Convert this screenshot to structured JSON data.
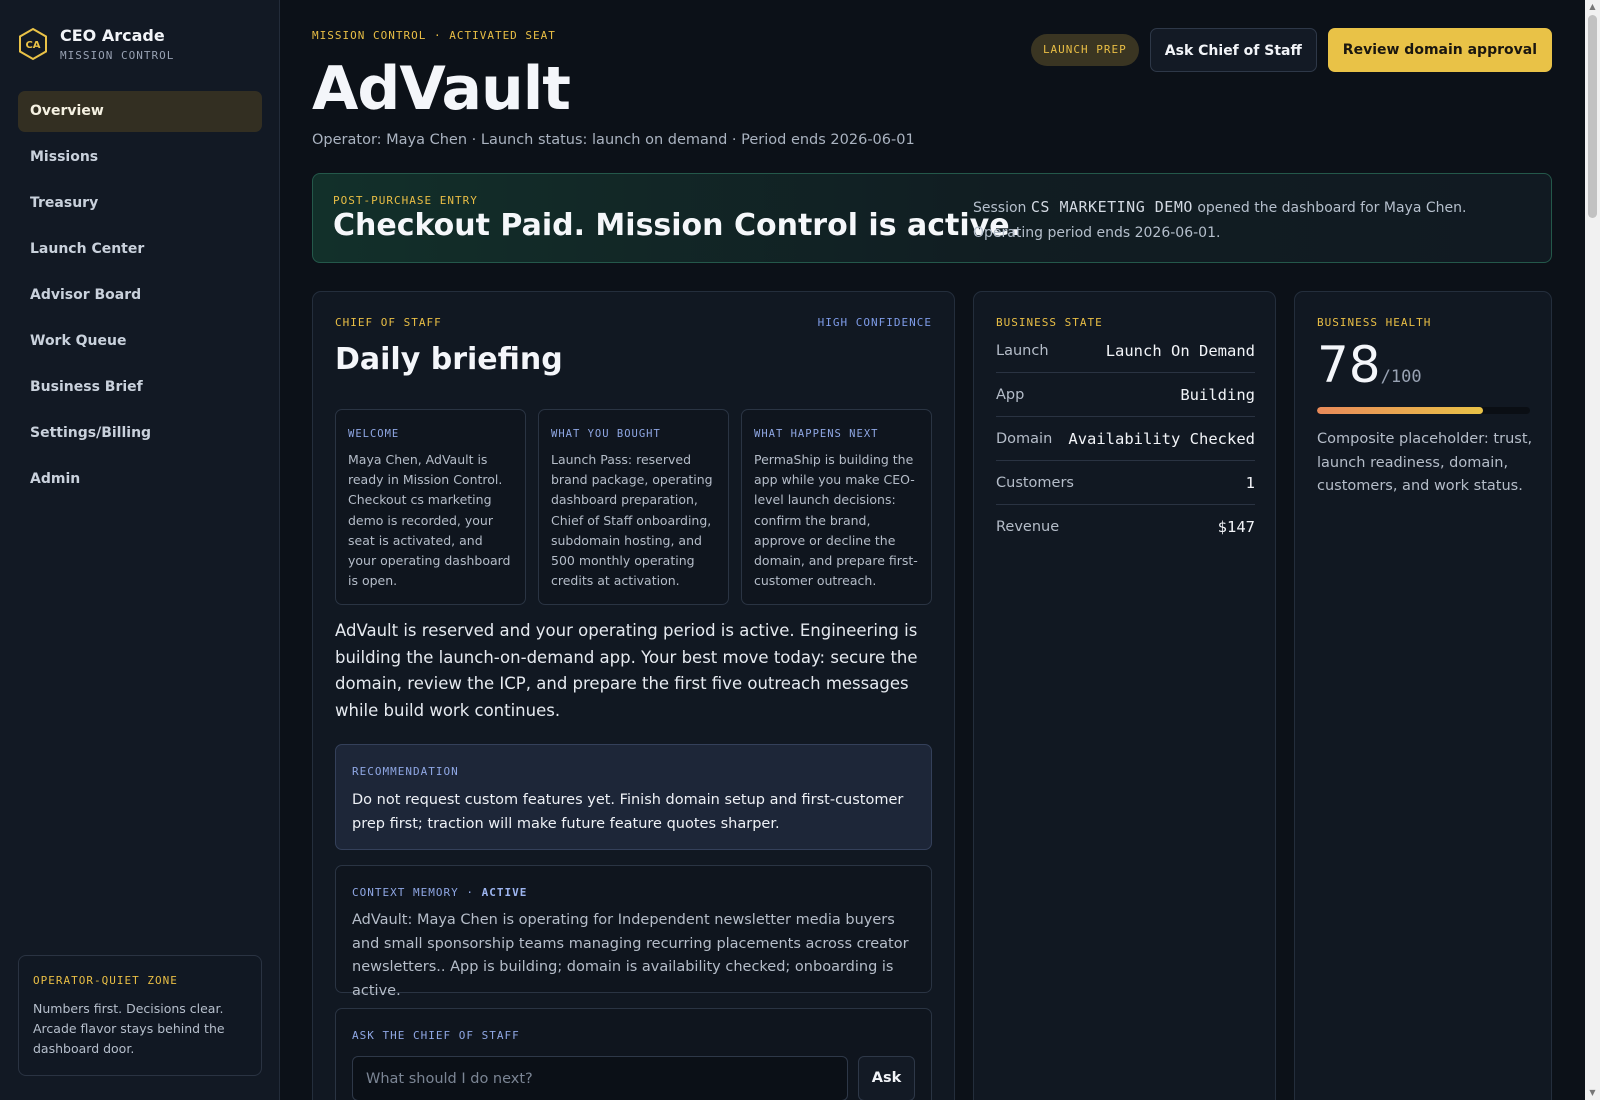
{
  "brand": {
    "logo_text": "CA",
    "name": "CEO Arcade",
    "sub": "MISSION CONTROL",
    "accent_color": "#e9c247"
  },
  "nav": {
    "items": [
      {
        "label": "Overview",
        "active": true
      },
      {
        "label": "Missions"
      },
      {
        "label": "Treasury"
      },
      {
        "label": "Launch Center"
      },
      {
        "label": "Advisor Board"
      },
      {
        "label": "Work Queue"
      },
      {
        "label": "Business Brief"
      },
      {
        "label": "Settings/Billing"
      },
      {
        "label": "Admin"
      }
    ]
  },
  "quiet_zone": {
    "title": "OPERATOR-QUIET ZONE",
    "text": "Numbers first. Decisions clear. Arcade flavor stays behind the dashboard door."
  },
  "header": {
    "eyebrow": "MISSION CONTROL · ACTIVATED SEAT",
    "title": "AdVault",
    "meta": "Operator: Maya Chen · Launch status: launch on demand · Period ends 2026-06-01",
    "pill": "LAUNCH PREP",
    "ask_button": "Ask Chief of Staff",
    "review_button": "Review domain approval"
  },
  "banner": {
    "eyebrow": "POST-PURCHASE ENTRY",
    "title": "Checkout Paid. Mission Control is active.",
    "text_prefix": "Session ",
    "session": "CS MARKETING DEMO",
    "text_suffix": " opened the dashboard for Maya Chen. Operating period ends 2026-06-01."
  },
  "briefing": {
    "label": "CHIEF OF STAFF",
    "confidence": "HIGH CONFIDENCE",
    "title": "Daily briefing",
    "cards": [
      {
        "label": "WELCOME",
        "text": "Maya Chen, AdVault is ready in Mission Control. Checkout cs marketing demo is recorded, your seat is activated, and your operating dashboard is open."
      },
      {
        "label": "WHAT YOU BOUGHT",
        "text": "Launch Pass: reserved brand package, operating dashboard preparation, Chief of Staff onboarding, subdomain hosting, and 500 monthly operating credits at activation."
      },
      {
        "label": "WHAT HAPPENS NEXT",
        "text": "PermaShip is building the app while you make CEO-level launch decisions: confirm the brand, approve or decline the domain, and prepare first-customer outreach."
      }
    ],
    "body": "AdVault is reserved and your operating period is active. Engineering is building the launch-on-demand app. Your best move today: secure the domain, review the ICP, and prepare the first five outreach messages while build work continues.",
    "recommendation": {
      "label": "RECOMMENDATION",
      "text": "Do not request custom features yet. Finish domain setup and first-customer prep first; traction will make future feature quotes sharper."
    },
    "memory": {
      "label": "CONTEXT MEMORY",
      "separator": " · ",
      "status": "ACTIVE",
      "text": "AdVault: Maya Chen is operating for Independent newsletter media buyers and small sponsorship teams managing recurring placements across creator newsletters.. App is building; domain is availability checked; onboarding is active."
    },
    "ask": {
      "label": "ASK THE CHIEF OF STAFF",
      "placeholder": "What should I do next?",
      "button": "Ask"
    }
  },
  "business_state": {
    "label": "BUSINESS STATE",
    "rows": [
      {
        "key": "Launch",
        "value": "Launch On Demand"
      },
      {
        "key": "App",
        "value": "Building"
      },
      {
        "key": "Domain",
        "value": "Availability Checked"
      },
      {
        "key": "Customers",
        "value": "1"
      },
      {
        "key": "Revenue",
        "value": "$147"
      }
    ]
  },
  "business_health": {
    "label": "BUSINESS HEALTH",
    "score": "78",
    "suffix": "/100",
    "fill_fraction": 0.78,
    "text": "Composite placeholder: trust, launch readiness, domain, customers, and work status."
  }
}
